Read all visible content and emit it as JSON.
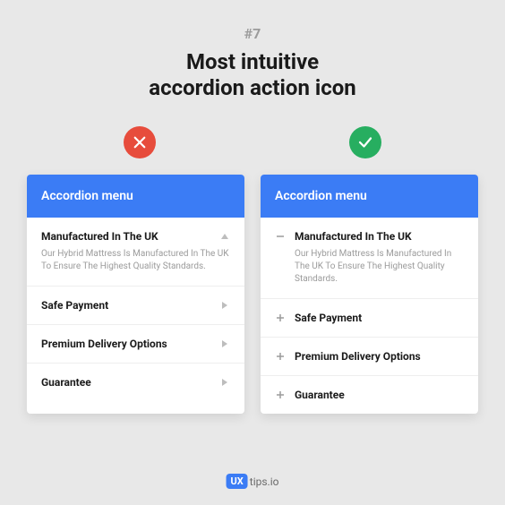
{
  "tip_number": "#7",
  "title_line1": "Most intuitive",
  "title_line2": "accordion action icon",
  "accordion_header": "Accordion menu",
  "items": [
    {
      "title": "Manufactured In The UK",
      "body": "Our Hybrid Mattress Is Manufactured In The UK To Ensure The Highest Quality Standards.",
      "expanded": true
    },
    {
      "title": "Safe Payment",
      "expanded": false
    },
    {
      "title": "Premium Delivery Options",
      "expanded": false
    },
    {
      "title": "Guarantee",
      "expanded": false
    }
  ],
  "brand": {
    "badge": "UX",
    "text": "tips.io"
  },
  "colors": {
    "bad": "#e74c3c",
    "good": "#27ae60",
    "accent": "#3b7cf5"
  }
}
